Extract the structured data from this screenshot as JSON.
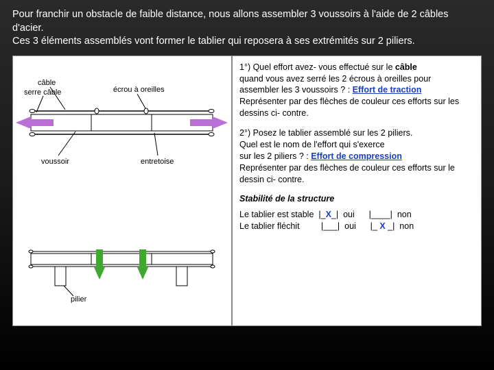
{
  "intro": {
    "line1": "Pour franchir un obstacle de faible distance, nous allons assembler 3 voussoirs à l'aide de 2 câbles d'acier.",
    "line2": "Ces 3 éléments assemblés vont former le tablier qui reposera à ses extrémités sur 2 piliers."
  },
  "diagram1": {
    "labels": {
      "cable": "câble",
      "serre_cable": "serre câble",
      "ecrou": "écrou à oreilles",
      "voussoir": "voussoir",
      "entretoise": "entretoise"
    }
  },
  "diagram2": {
    "labels": {
      "pilier": "pilier"
    }
  },
  "q1": {
    "prefix": "1°) Quel effort avez- vous effectué sur le ",
    "cable": "câble",
    "line2": "quand vous avez serré les 2 écrous à oreilles pour",
    "line3a": "assembler les 3 voussoirs ? : ",
    "answer": "Effort de traction",
    "line4": "Représenter par des flèches de couleur ces efforts sur les dessins ci- contre."
  },
  "q2": {
    "line1": " 2°) Posez le tablier assemblé sur les 2 piliers.",
    "line2": "Quel est le nom de l'effort qui s'exerce",
    "line3a": "sur les 2 piliers ? : ",
    "answer": "Effort de compression",
    "line4": "Représenter par des flèches de couleur ces efforts sur le dessin ci- contre."
  },
  "stability": {
    "title": "Stabilité de la structure",
    "row1_label": "Le tablier est stable",
    "row2_label": "Le tablier fléchit",
    "oui": "oui",
    "non": "non",
    "x": "X"
  }
}
